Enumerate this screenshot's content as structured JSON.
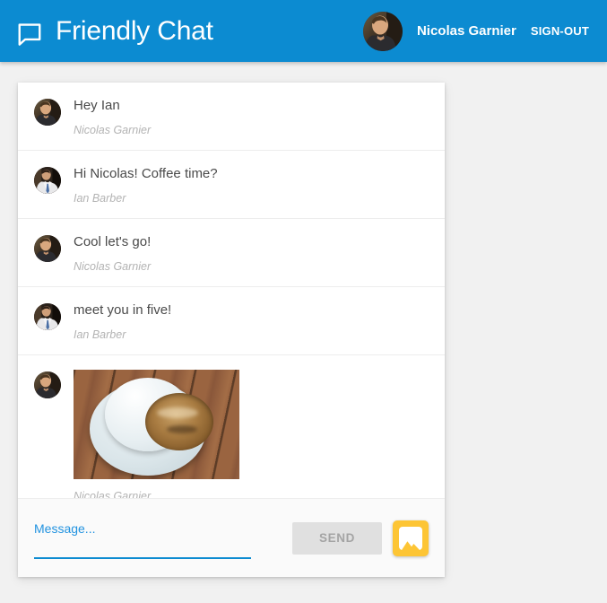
{
  "header": {
    "app_title": "Friendly Chat",
    "logo_icon": "chat-bubble-icon",
    "user_name": "Nicolas Garnier",
    "sign_out_label": "SIGN-OUT",
    "avatar_alt": "Nicolas Garnier profile photo",
    "background_color": "#0C8BD1",
    "text_color": "#FFFFFF"
  },
  "page": {
    "background_color": "#F1F1F1",
    "card_background": "#FFFFFF"
  },
  "messages": [
    {
      "author": "Nicolas Garnier",
      "text": "Hey Ian",
      "type": "text",
      "avatar": "nicolas-avatar"
    },
    {
      "author": "Ian Barber",
      "text": "Hi Nicolas! Coffee time?",
      "type": "text",
      "avatar": "ian-avatar"
    },
    {
      "author": "Nicolas Garnier",
      "text": "Cool let's go!",
      "type": "text",
      "avatar": "nicolas-avatar"
    },
    {
      "author": "Ian Barber",
      "text": "meet you in five!",
      "type": "text",
      "avatar": "ian-avatar"
    },
    {
      "author": "Nicolas Garnier",
      "text": "",
      "type": "image",
      "image_alt": "Cup of coffee on a wooden table",
      "avatar": "nicolas-avatar"
    }
  ],
  "composer": {
    "message_label": "Message...",
    "message_value": "",
    "message_placeholder": "",
    "send_label": "SEND",
    "send_disabled": true,
    "image_button_icon": "image-upload-icon",
    "label_color": "#2293E0",
    "underline_color": "#0C8BD1",
    "send_background": "#E0E0E0",
    "send_text_color": "#A4A4A4",
    "image_button_color": "#FDC535"
  }
}
